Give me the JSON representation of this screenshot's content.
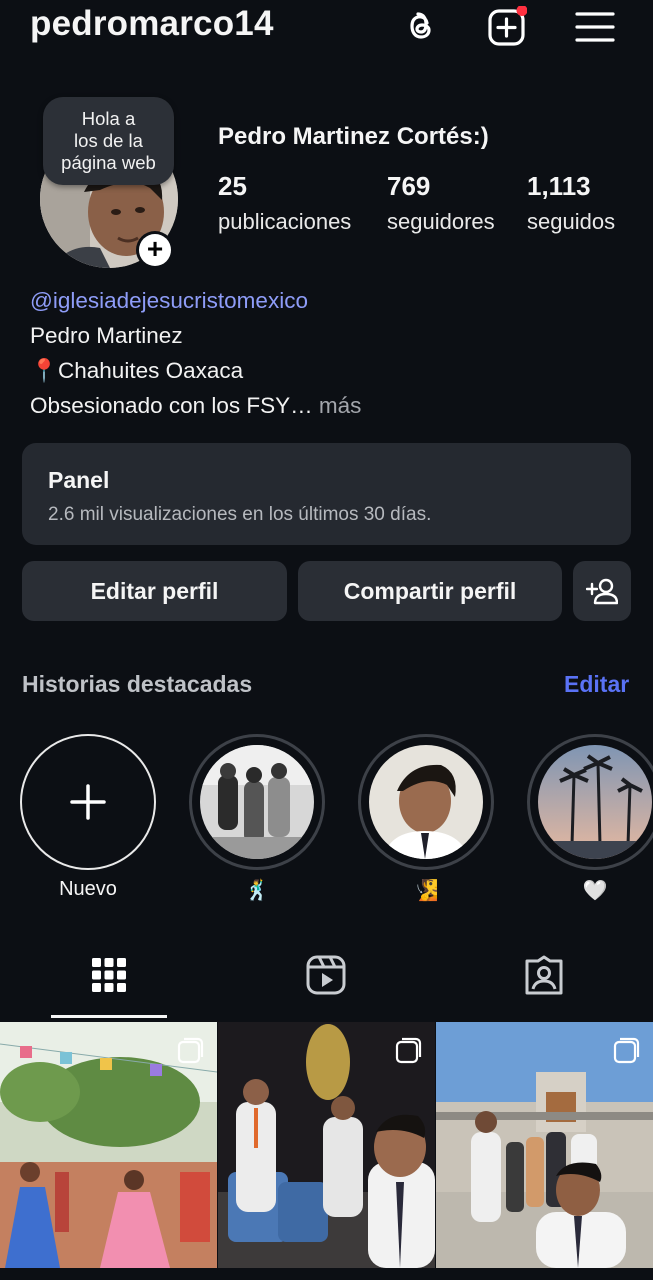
{
  "header": {
    "username": "pedromarco14",
    "icons": [
      "threads-icon",
      "create-post-icon",
      "menu-icon"
    ],
    "notification_dot_color": "#ff3040"
  },
  "profile": {
    "note": [
      "Hola a",
      "los de la",
      "página web"
    ],
    "display_name": "Pedro Martinez Cortés:)",
    "stats": [
      {
        "value": "25",
        "label": "publicaciones"
      },
      {
        "value": "769",
        "label": "seguidores"
      },
      {
        "value": "1,113",
        "label": "seguidos"
      }
    ],
    "bio": {
      "link": "@iglesiadejesucristomexico",
      "line1": "Pedro Martinez",
      "line2": "📍Chahuites Oaxaca",
      "line3": "Obsesionado con los FSY…",
      "more": " más"
    }
  },
  "panel": {
    "title": "Panel",
    "subtitle": "2.6 mil visualizaciones en los últimos 30 días."
  },
  "actions": {
    "edit": "Editar perfil",
    "share": "Compartir perfil"
  },
  "highlights": {
    "title": "Historias destacadas",
    "edit": "Editar",
    "new_label": "Nuevo",
    "items": [
      {
        "label": "🕺"
      },
      {
        "label": "🧏"
      },
      {
        "label": "🤍"
      }
    ]
  },
  "tabs": [
    "grid-icon",
    "reels-icon",
    "tagged-icon"
  ],
  "colors": {
    "background": "#0c0f14",
    "link": "#8e9cf7",
    "accent": "#5a72f5",
    "surface": "#2a2e35"
  }
}
